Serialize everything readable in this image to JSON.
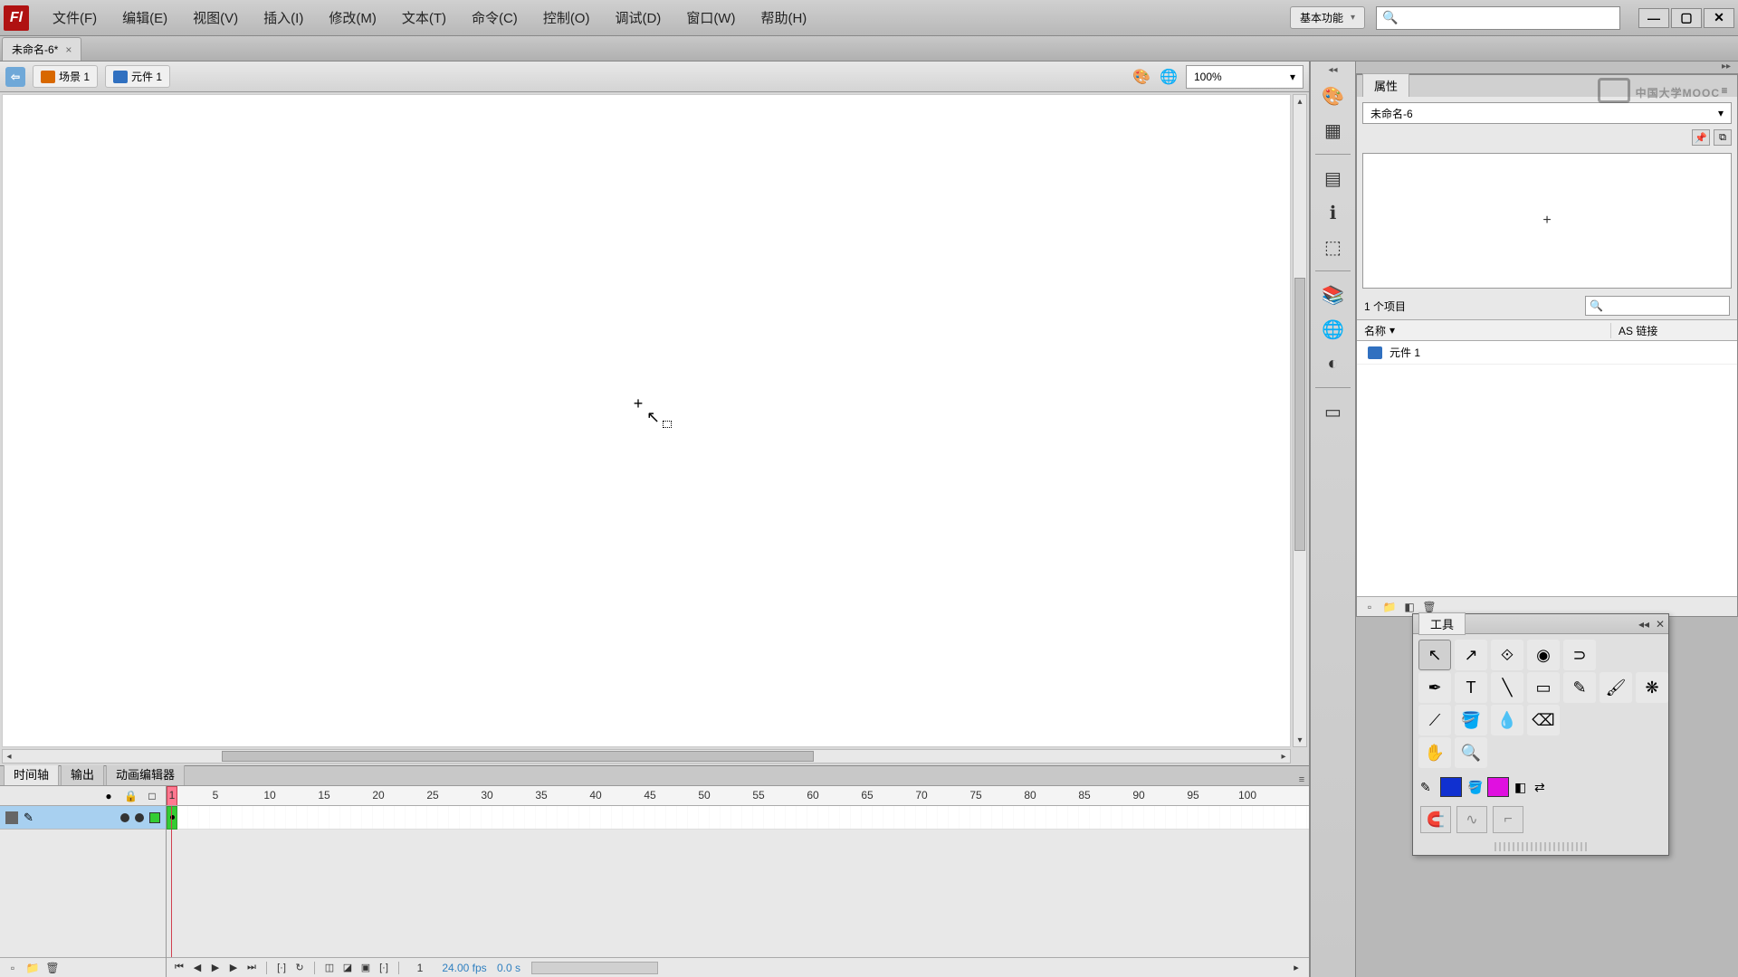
{
  "menu": {
    "file": "文件(F)",
    "edit": "编辑(E)",
    "view": "视图(V)",
    "insert": "插入(I)",
    "modify": "修改(M)",
    "text": "文本(T)",
    "commands": "命令(C)",
    "control": "控制(O)",
    "debug": "调试(D)",
    "window": "窗口(W)",
    "help": "帮助(H)"
  },
  "workspace": {
    "label": "基本功能"
  },
  "window_controls": {
    "min": "—",
    "max": "▢",
    "close": "✕"
  },
  "document": {
    "tab": "未命名-6*",
    "close": "×"
  },
  "breadcrumb": {
    "back": "⇦",
    "scene": "场景 1",
    "symbol": "元件 1"
  },
  "zoom": {
    "value": "100%",
    "arrow": "▾"
  },
  "timeline": {
    "tabs": {
      "timeline": "时间轴",
      "output": "输出",
      "motion": "动画编辑器"
    },
    "ruler_numbers": [
      1,
      5,
      10,
      15,
      20,
      25,
      30,
      35,
      40,
      45,
      50,
      55,
      60,
      65,
      70,
      75,
      80,
      85,
      90,
      95,
      100
    ],
    "status": {
      "frame": "1",
      "fps": "24.00 fps",
      "time": "0.0 s"
    },
    "layer_icons": {
      "eye": "●",
      "lock": "🔒",
      "outline": "□"
    }
  },
  "library": {
    "tab": "属性",
    "doc_dropdown": "未命名-6",
    "count": "1 个项目",
    "col_name": "名称",
    "col_link": "AS 链接",
    "items": [
      {
        "name": "元件 1"
      }
    ],
    "search_ph": ""
  },
  "tools": {
    "title": "工具"
  },
  "watermark": "中国大学MOOC",
  "colors": {
    "stroke": "#1030d0",
    "fill": "#e010e0"
  },
  "icons": {
    "search": "🔍",
    "paint": "🎨",
    "globe": "🌐",
    "grid": "▦",
    "align": "▤",
    "info": "ℹ",
    "transform": "⬚",
    "library": "📚",
    "swatch": "🎨",
    "color": "◐",
    "component": "▭",
    "arrow_up": "▴",
    "arrow_down": "▾",
    "arrow_left": "◂",
    "arrow_right": "▸",
    "sort": "▾",
    "menu": "≡",
    "play_first": "⏮",
    "play_prev": "◀",
    "play": "▶",
    "play_next": "▶",
    "play_last": "⏭",
    "loop": "↻",
    "onion": "◫",
    "onion2": "◪",
    "onion3": "▣",
    "marker": "[·]",
    "new": "▫",
    "folder": "📁",
    "trash": "🗑",
    "props": "◧",
    "link": "🔗",
    "pin": "📌",
    "dup": "⧉",
    "sel": "↖",
    "subsel": "↗",
    "free": "⟐",
    "threed": "◉",
    "lasso": "⊃",
    "pen": "✒",
    "text": "T",
    "line": "╲",
    "rect": "▭",
    "pencil": "✎",
    "brush": "🖌",
    "deco": "❋",
    "bone": "⟋",
    "bucket": "🪣",
    "dropper": "💧",
    "eraser": "⌫",
    "hand": "✋",
    "zoom": "🔍",
    "strokecolor": "✎",
    "fillcolor": "🪣",
    "bw": "◧",
    "swap": "⇄",
    "snap": "🧲",
    "smooth": "∿",
    "straight": "⌐"
  }
}
